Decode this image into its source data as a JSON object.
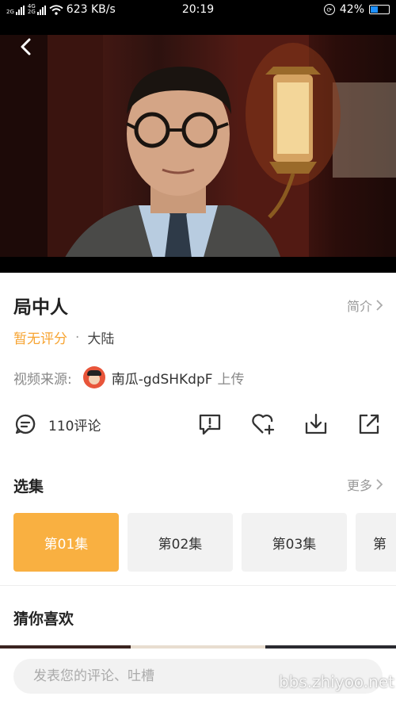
{
  "status_bar": {
    "network_small_top": "2G",
    "network_small_bottom": "2G",
    "network_4g": "4G",
    "speed": "623 KB/s",
    "time": "20:19",
    "battery": "42%",
    "battery_level": 0.42
  },
  "video": {
    "back_icon": "chevron-left-icon"
  },
  "show": {
    "title": "局中人",
    "intro_label": "简介",
    "score": "暂无评分",
    "separator": "·",
    "region": "大陆"
  },
  "source": {
    "label": "视频来源:",
    "uploader": "南瓜-gdSHKdpF",
    "upload_text": "上传"
  },
  "actions": {
    "comments": "110评论",
    "icons": [
      "comment-icon",
      "report-icon",
      "favorite-add-icon",
      "download-icon",
      "share-icon"
    ]
  },
  "episodes_section": {
    "title": "选集",
    "more": "更多",
    "items": [
      "第01集",
      "第02集",
      "第03集",
      "第"
    ]
  },
  "recommend": {
    "title": "猜你喜欢"
  },
  "comment_bar": {
    "placeholder": "发表您的评论、吐槽"
  },
  "watermark": "bbs.zhiyoo.net",
  "colors": {
    "accent": "#f9b041",
    "score": "#f7a432",
    "muted": "#999999"
  }
}
